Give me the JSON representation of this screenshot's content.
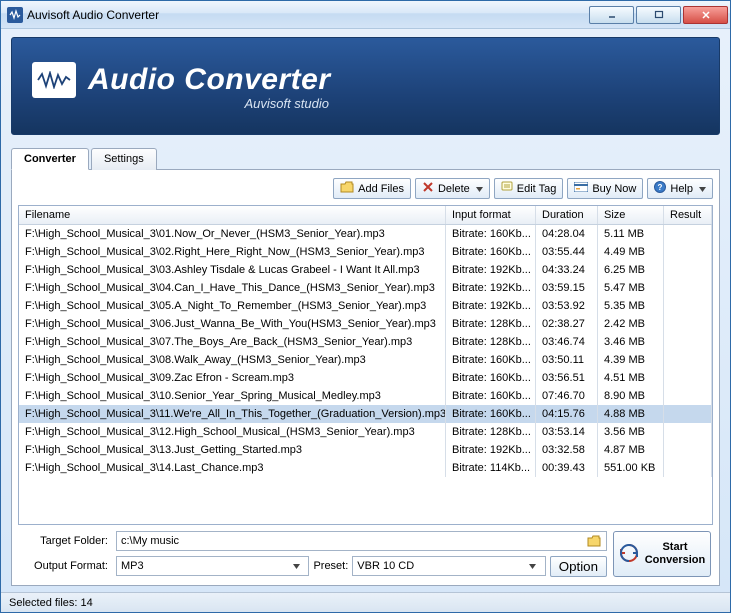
{
  "window": {
    "title": "Auvisoft Audio Converter"
  },
  "banner": {
    "title": "Audio Converter",
    "subtitle": "Auvisoft studio"
  },
  "tabs": [
    {
      "id": "converter",
      "label": "Converter",
      "active": true
    },
    {
      "id": "settings",
      "label": "Settings",
      "active": false
    }
  ],
  "toolbar": {
    "add_files": "Add Files",
    "delete": "Delete",
    "edit_tag": "Edit Tag",
    "buy_now": "Buy Now",
    "help": "Help"
  },
  "columns": {
    "filename": "Filename",
    "input_format": "Input format",
    "duration": "Duration",
    "size": "Size",
    "result": "Result"
  },
  "files": [
    {
      "path": "F:\\High_School_Musical_3\\01.Now_Or_Never_(HSM3_Senior_Year).mp3",
      "fmt": "Bitrate: 160Kb...",
      "dur": "04:28.04",
      "size": "5.11 MB"
    },
    {
      "path": "F:\\High_School_Musical_3\\02.Right_Here_Right_Now_(HSM3_Senior_Year).mp3",
      "fmt": "Bitrate: 160Kb...",
      "dur": "03:55.44",
      "size": "4.49 MB"
    },
    {
      "path": "F:\\High_School_Musical_3\\03.Ashley Tisdale & Lucas Grabeel - I Want It All.mp3",
      "fmt": "Bitrate: 192Kb...",
      "dur": "04:33.24",
      "size": "6.25 MB"
    },
    {
      "path": "F:\\High_School_Musical_3\\04.Can_I_Have_This_Dance_(HSM3_Senior_Year).mp3",
      "fmt": "Bitrate: 192Kb...",
      "dur": "03:59.15",
      "size": "5.47 MB"
    },
    {
      "path": "F:\\High_School_Musical_3\\05.A_Night_To_Remember_(HSM3_Senior_Year).mp3",
      "fmt": "Bitrate: 192Kb...",
      "dur": "03:53.92",
      "size": "5.35 MB"
    },
    {
      "path": "F:\\High_School_Musical_3\\06.Just_Wanna_Be_With_You(HSM3_Senior_Year).mp3",
      "fmt": "Bitrate: 128Kb...",
      "dur": "02:38.27",
      "size": "2.42 MB"
    },
    {
      "path": "F:\\High_School_Musical_3\\07.The_Boys_Are_Back_(HSM3_Senior_Year).mp3",
      "fmt": "Bitrate: 128Kb...",
      "dur": "03:46.74",
      "size": "3.46 MB"
    },
    {
      "path": "F:\\High_School_Musical_3\\08.Walk_Away_(HSM3_Senior_Year).mp3",
      "fmt": "Bitrate: 160Kb...",
      "dur": "03:50.11",
      "size": "4.39 MB"
    },
    {
      "path": "F:\\High_School_Musical_3\\09.Zac Efron - Scream.mp3",
      "fmt": "Bitrate: 160Kb...",
      "dur": "03:56.51",
      "size": "4.51 MB"
    },
    {
      "path": "F:\\High_School_Musical_3\\10.Senior_Year_Spring_Musical_Medley.mp3",
      "fmt": "Bitrate: 160Kb...",
      "dur": "07:46.70",
      "size": "8.90 MB"
    },
    {
      "path": "F:\\High_School_Musical_3\\11.We're_All_In_This_Together_(Graduation_Version).mp3",
      "fmt": "Bitrate: 160Kb...",
      "dur": "04:15.76",
      "size": "4.88 MB",
      "selected": true
    },
    {
      "path": "F:\\High_School_Musical_3\\12.High_School_Musical_(HSM3_Senior_Year).mp3",
      "fmt": "Bitrate: 128Kb...",
      "dur": "03:53.14",
      "size": "3.56 MB"
    },
    {
      "path": "F:\\High_School_Musical_3\\13.Just_Getting_Started.mp3",
      "fmt": "Bitrate: 192Kb...",
      "dur": "03:32.58",
      "size": "4.87 MB"
    },
    {
      "path": "F:\\High_School_Musical_3\\14.Last_Chance.mp3",
      "fmt": "Bitrate: 114Kb...",
      "dur": "00:39.43",
      "size": "551.00 KB"
    }
  ],
  "target": {
    "label": "Target Folder:",
    "value": "c:\\My music"
  },
  "output": {
    "label": "Output Format:",
    "value": "MP3",
    "preset_label": "Preset:",
    "preset_value": "VBR 10 CD",
    "option_label": "Option"
  },
  "start": {
    "label1": "Start",
    "label2": "Conversion"
  },
  "status": "Selected files: 14"
}
